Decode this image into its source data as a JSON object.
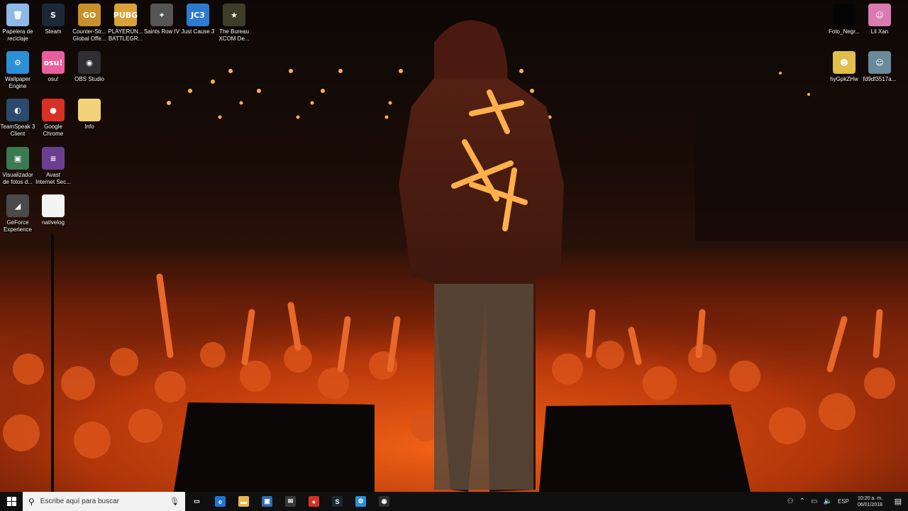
{
  "desktop": {
    "left_icons": [
      {
        "name": "recycle-bin-icon",
        "label_1": "Papelera de",
        "label_2": "reciclaje",
        "glyph": "🗑",
        "color": "#8fb9e6"
      },
      {
        "name": "steam-icon",
        "label_1": "Steam",
        "label_2": "",
        "glyph": "S",
        "color": "#1b2838"
      },
      {
        "name": "csgo-icon",
        "label_1": "Counter-Str...",
        "label_2": "Global Offe...",
        "glyph": "GO",
        "color": "#c7902a"
      },
      {
        "name": "pubg-icon",
        "label_1": "PLAYERUN...",
        "label_2": "BATTLEGR...",
        "glyph": "PUBG",
        "color": "#d9a23a"
      },
      {
        "name": "saints-row-icon",
        "label_1": "Saints Row IV",
        "label_2": "",
        "glyph": "✦",
        "color": "#555"
      },
      {
        "name": "just-cause-icon",
        "label_1": "Just Cause 3",
        "label_2": "",
        "glyph": "JC3",
        "color": "#2f7ad1"
      },
      {
        "name": "xcom-icon",
        "label_1": "The Bureau",
        "label_2": "XCOM De...",
        "glyph": "★",
        "color": "#3d3d2a"
      },
      {
        "name": "wallpaper-engine-icon",
        "label_1": "Wallpaper",
        "label_2": "Engine",
        "glyph": "⚙",
        "color": "#2d8fd6"
      },
      {
        "name": "osu-icon",
        "label_1": "osu!",
        "label_2": "",
        "glyph": "osu!",
        "color": "#ea5ea0"
      },
      {
        "name": "obs-icon",
        "label_1": "OBS Studio",
        "label_2": "",
        "glyph": "◉",
        "color": "#302e31"
      },
      {
        "name": "teamspeak-icon",
        "label_1": "TeamSpeak 3",
        "label_2": "Client",
        "glyph": "◐",
        "color": "#2b4a6e"
      },
      {
        "name": "chrome-icon",
        "label_1": "Google",
        "label_2": "Chrome",
        "glyph": "●",
        "color": "#d93025"
      },
      {
        "name": "folder-icon",
        "label_1": "Info",
        "label_2": "",
        "glyph": "",
        "color": "#f2d27a"
      },
      {
        "name": "photo-viewer-icon",
        "label_1": "Visualizador",
        "label_2": "de fotos d...",
        "glyph": "▣",
        "color": "#3a7a52"
      },
      {
        "name": "avast-icon",
        "label_1": "Avast",
        "label_2": "Internet Sec...",
        "glyph": "≡",
        "color": "#6a3f8f"
      },
      {
        "name": "geforce-icon",
        "label_1": "GeForce",
        "label_2": "Experience",
        "glyph": "◢",
        "color": "#4a4a4a"
      },
      {
        "name": "text-file-icon",
        "label_1": "nativelog",
        "label_2": "",
        "glyph": "",
        "color": "#f4f4f4"
      }
    ],
    "right_icons": [
      {
        "name": "foto-negra-icon",
        "label_1": "Foto_Negr...",
        "label_2": "",
        "glyph": "",
        "color": "#050505"
      },
      {
        "name": "lil-xan-icon",
        "label_1": "Lil Xan",
        "label_2": "",
        "glyph": "☺",
        "color": "#d97ab0"
      },
      {
        "name": "image-hy-icon",
        "label_1": "hyGpkZHw",
        "label_2": "",
        "glyph": "☻",
        "color": "#e0c04a"
      },
      {
        "name": "image-fd-icon",
        "label_1": "fd9df3517a...",
        "label_2": "",
        "glyph": "☺",
        "color": "#6a8a9a"
      }
    ]
  },
  "taskbar": {
    "start_icon": "windows-icon",
    "search_placeholder": "Escribe aquí para buscar",
    "apps": [
      {
        "name": "task-view-icon",
        "glyph": "▭",
        "color": "#101010"
      },
      {
        "name": "edge-icon",
        "glyph": "e",
        "color": "#1e74d8"
      },
      {
        "name": "file-explorer-icon",
        "glyph": "▬",
        "color": "#e8b84a"
      },
      {
        "name": "store-icon",
        "glyph": "▣",
        "color": "#2b6cb0"
      },
      {
        "name": "mail-icon",
        "glyph": "✉",
        "color": "#3a3a3a"
      },
      {
        "name": "chrome-icon",
        "glyph": "●",
        "color": "#d93025"
      },
      {
        "name": "steam-icon",
        "glyph": "S",
        "color": "#1b2838"
      },
      {
        "name": "wallpaper-engine-icon",
        "glyph": "⚙",
        "color": "#2d8fd6"
      },
      {
        "name": "obs-icon",
        "glyph": "◉",
        "color": "#302e31"
      }
    ],
    "tray": {
      "language": "ESP",
      "time": "10:20 a. m.",
      "date": "06/01/2018"
    }
  }
}
